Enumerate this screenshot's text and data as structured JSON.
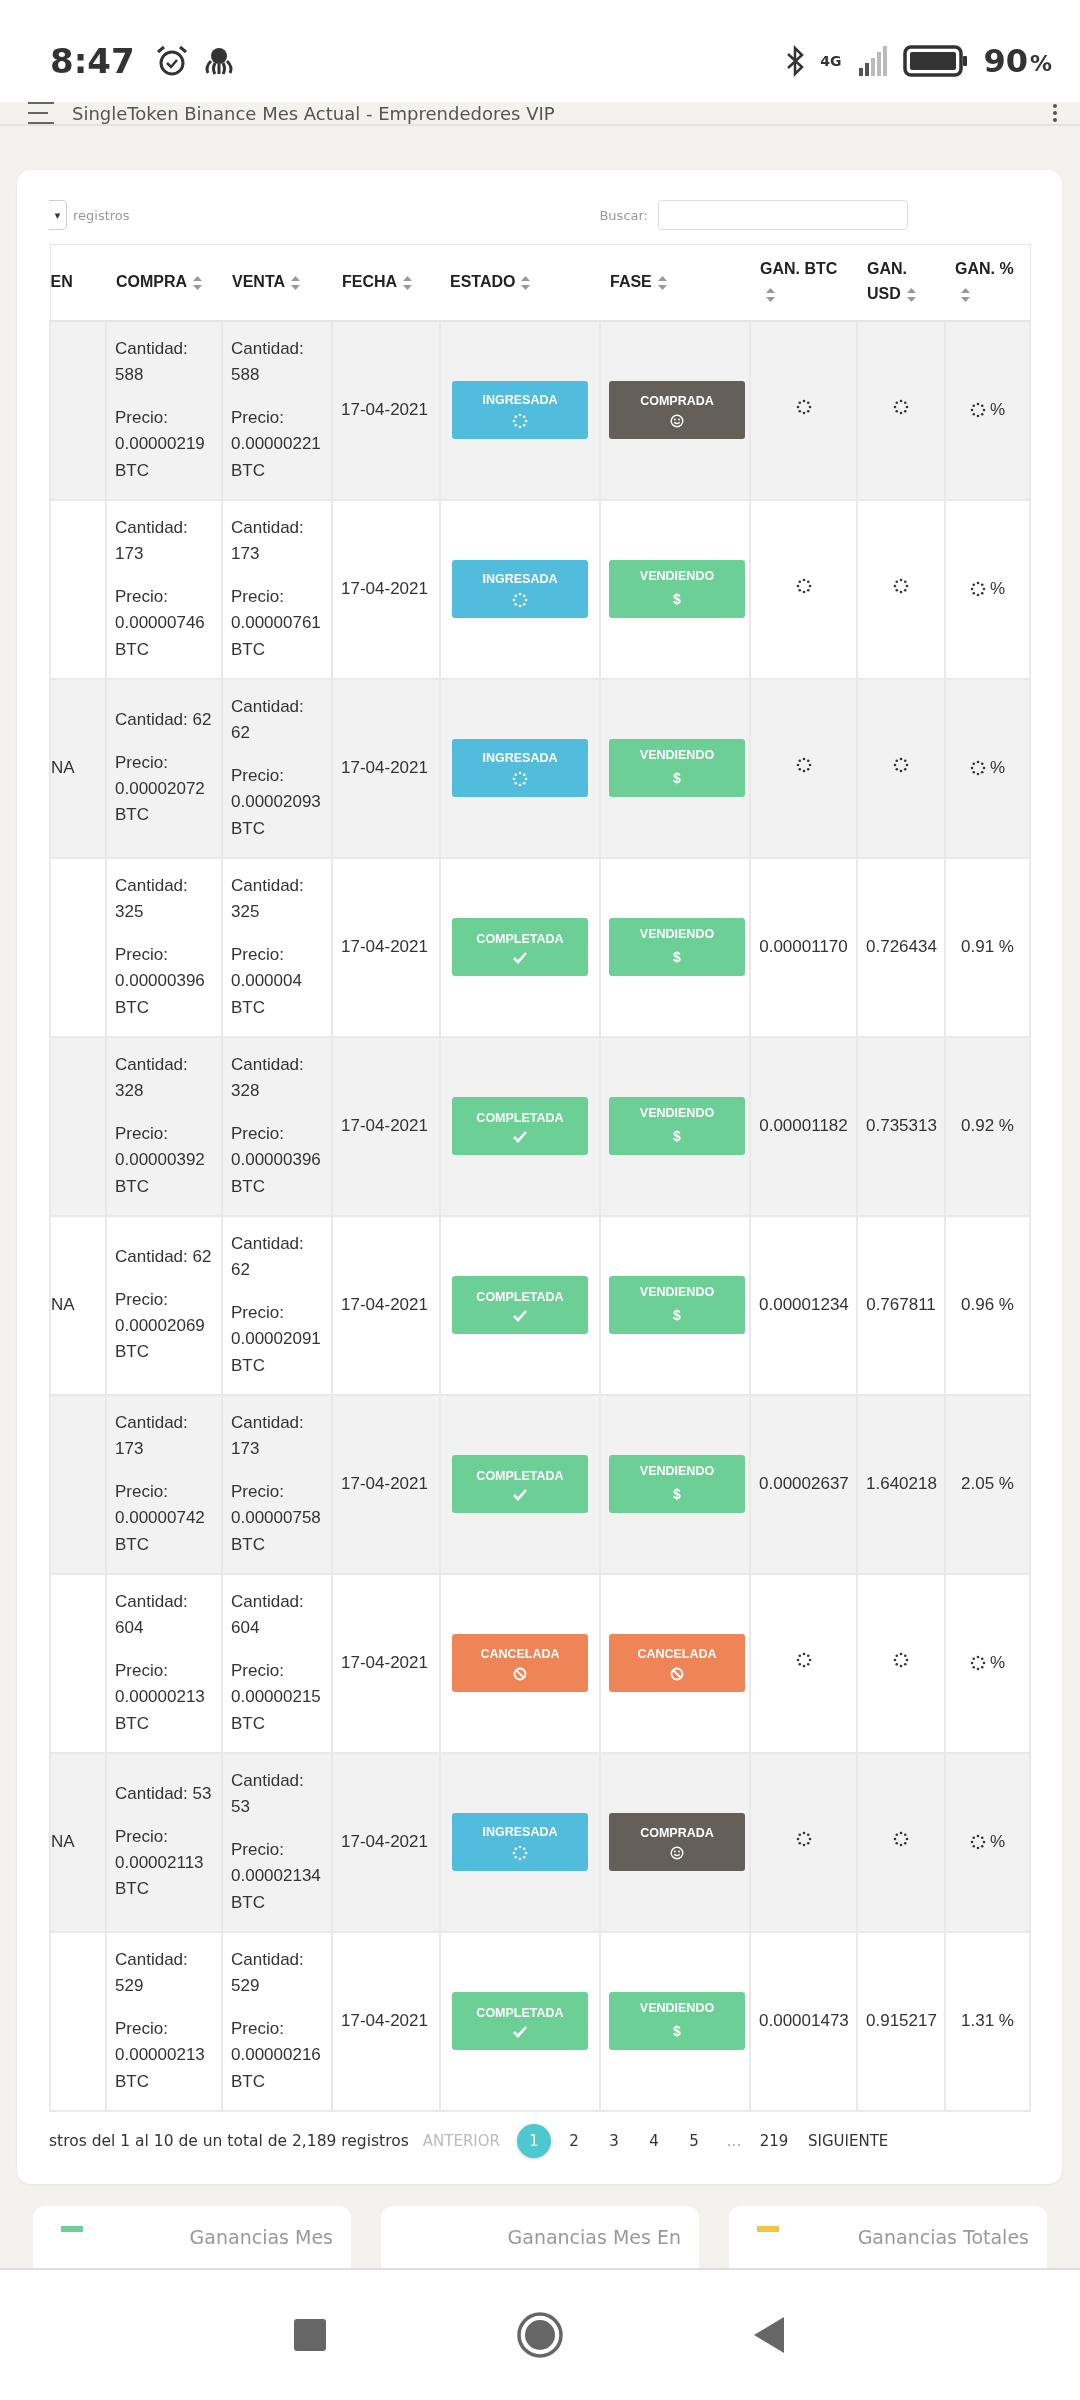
{
  "status_bar": {
    "time": "8:47",
    "network": "4G",
    "battery": "90",
    "battery_unit": "%"
  },
  "app_bar": {
    "title": "SingleToken Binance Mes Actual - Emprendedores VIP"
  },
  "table_controls": {
    "length_caret": "▾",
    "length_label": "registros",
    "search_label": "Buscar:"
  },
  "table": {
    "columns": [
      {
        "label": "EN",
        "sortable": false
      },
      {
        "label": "COMPRA",
        "sortable": true
      },
      {
        "label": "VENTA",
        "sortable": true
      },
      {
        "label": "FECHA",
        "sortable": true
      },
      {
        "label": "ESTADO",
        "sortable": true
      },
      {
        "label": "FASE",
        "sortable": true
      },
      {
        "label": "GAN. BTC",
        "sortable": true
      },
      {
        "label": "GAN. USD",
        "sortable": true
      },
      {
        "label": "GAN. %",
        "sortable": true
      }
    ],
    "rows": [
      {
        "buy_qty": "Cantidad: 588",
        "buy_price": "Precio: 0.00000219 BTC",
        "sell_qty": "Cantidad: 588",
        "sell_price": "Precio: 0.00000221 BTC",
        "date": "17-04-2021",
        "status": {
          "kind": "ingresada",
          "label": "INGRESADA"
        },
        "phase": {
          "kind": "comprada",
          "label": "COMPRADA"
        },
        "gains_loading": true,
        "gan_pct": "%"
      },
      {
        "buy_qty": "Cantidad: 173",
        "buy_price": "Precio: 0.00000746 BTC",
        "sell_qty": "Cantidad: 173",
        "sell_price": "Precio: 0.00000761 BTC",
        "date": "17-04-2021",
        "status": {
          "kind": "ingresada",
          "label": "INGRESADA"
        },
        "phase": {
          "kind": "vendiendo",
          "label": "VENDIENDO",
          "symbol": "$"
        },
        "gains_loading": true,
        "gan_pct": "%"
      },
      {
        "column_1": "NA",
        "buy_qty": "Cantidad: 62",
        "buy_price": "Precio: 0.00002072 BTC",
        "sell_qty": "Cantidad: 62",
        "sell_price": "Precio: 0.00002093 BTC",
        "date": "17-04-2021",
        "status": {
          "kind": "ingresada",
          "label": "INGRESADA"
        },
        "phase": {
          "kind": "vendiendo",
          "label": "VENDIENDO",
          "symbol": "$"
        },
        "gains_loading": true,
        "gan_pct": "%"
      },
      {
        "buy_qty": "Cantidad: 325",
        "buy_price": "Precio: 0.00000396 BTC",
        "sell_qty": "Cantidad: 325",
        "sell_price": "Precio: 0.000004 BTC",
        "date": "17-04-2021",
        "status": {
          "kind": "completada",
          "label": "COMPLETADA"
        },
        "phase": {
          "kind": "vendiendo",
          "label": "VENDIENDO",
          "symbol": "$"
        },
        "gains_loading": false,
        "gan_btc": "0.00001170",
        "gan_usd": "0.726434",
        "gan_pct": "0.91 %"
      },
      {
        "buy_qty": "Cantidad: 328",
        "buy_price": "Precio: 0.00000392 BTC",
        "sell_qty": "Cantidad: 328",
        "sell_price": "Precio: 0.00000396 BTC",
        "date": "17-04-2021",
        "status": {
          "kind": "completada",
          "label": "COMPLETADA"
        },
        "phase": {
          "kind": "vendiendo",
          "label": "VENDIENDO",
          "symbol": "$"
        },
        "gains_loading": false,
        "gan_btc": "0.00001182",
        "gan_usd": "0.735313",
        "gan_pct": "0.92 %"
      },
      {
        "column_1": "NA",
        "buy_qty": "Cantidad: 62",
        "buy_price": "Precio: 0.00002069 BTC",
        "sell_qty": "Cantidad: 62",
        "sell_price": "Precio: 0.00002091 BTC",
        "date": "17-04-2021",
        "status": {
          "kind": "completada",
          "label": "COMPLETADA"
        },
        "phase": {
          "kind": "vendiendo",
          "label": "VENDIENDO",
          "symbol": "$"
        },
        "gains_loading": false,
        "gan_btc": "0.00001234",
        "gan_usd": "0.767811",
        "gan_pct": "0.96 %"
      },
      {
        "buy_qty": "Cantidad: 173",
        "buy_price": "Precio: 0.00000742 BTC",
        "sell_qty": "Cantidad: 173",
        "sell_price": "Precio: 0.00000758 BTC",
        "date": "17-04-2021",
        "status": {
          "kind": "completada",
          "label": "COMPLETADA"
        },
        "phase": {
          "kind": "vendiendo",
          "label": "VENDIENDO",
          "symbol": "$"
        },
        "gains_loading": false,
        "gan_btc": "0.00002637",
        "gan_usd": "1.640218",
        "gan_pct": "2.05 %"
      },
      {
        "buy_qty": "Cantidad: 604",
        "buy_price": "Precio: 0.00000213 BTC",
        "sell_qty": "Cantidad: 604",
        "sell_price": "Precio: 0.00000215 BTC",
        "date": "17-04-2021",
        "status": {
          "kind": "cancelada",
          "label": "CANCELADA"
        },
        "phase": {
          "kind": "cancelada",
          "label": "CANCELADA"
        },
        "gains_loading": true,
        "gan_pct": "%"
      },
      {
        "column_1": "NA",
        "buy_qty": "Cantidad: 53",
        "buy_price": "Precio: 0.00002113 BTC",
        "sell_qty": "Cantidad: 53",
        "sell_price": "Precio: 0.00002134 BTC",
        "date": "17-04-2021",
        "status": {
          "kind": "ingresada",
          "label": "INGRESADA"
        },
        "phase": {
          "kind": "comprada",
          "label": "COMPRADA"
        },
        "gains_loading": true,
        "gan_pct": "%"
      },
      {
        "buy_qty": "Cantidad: 529",
        "buy_price": "Precio: 0.00000213 BTC",
        "sell_qty": "Cantidad: 529",
        "sell_price": "Precio: 0.00000216 BTC",
        "date": "17-04-2021",
        "status": {
          "kind": "completada",
          "label": "COMPLETADA"
        },
        "phase": {
          "kind": "vendiendo",
          "label": "VENDIENDO",
          "symbol": "$"
        },
        "gains_loading": false,
        "gan_btc": "0.00001473",
        "gan_usd": "0.915217",
        "gan_pct": "1.31 %"
      }
    ]
  },
  "pagination": {
    "info": "stros del 1 al 10 de un total de 2,189 registros",
    "previous": {
      "label": "ANTERIOR",
      "disabled": true
    },
    "pages": [
      {
        "label": "1",
        "selected": true
      },
      {
        "label": "2",
        "selected": false
      },
      {
        "label": "3",
        "selected": false
      },
      {
        "label": "4",
        "selected": false
      },
      {
        "label": "5",
        "selected": false
      },
      {
        "label": "…",
        "selected": false,
        "kind": "gap"
      },
      {
        "label": "219",
        "selected": false
      }
    ],
    "next": {
      "label": "SIGUIENTE",
      "disabled": false
    }
  },
  "summary_cards": [
    {
      "title": "Ganancias Mes",
      "color": "#6ccf95"
    },
    {
      "title": "Ganancias Mes En"
    },
    {
      "title": "Ganancias Totales",
      "color": "#f4c542"
    }
  ]
}
